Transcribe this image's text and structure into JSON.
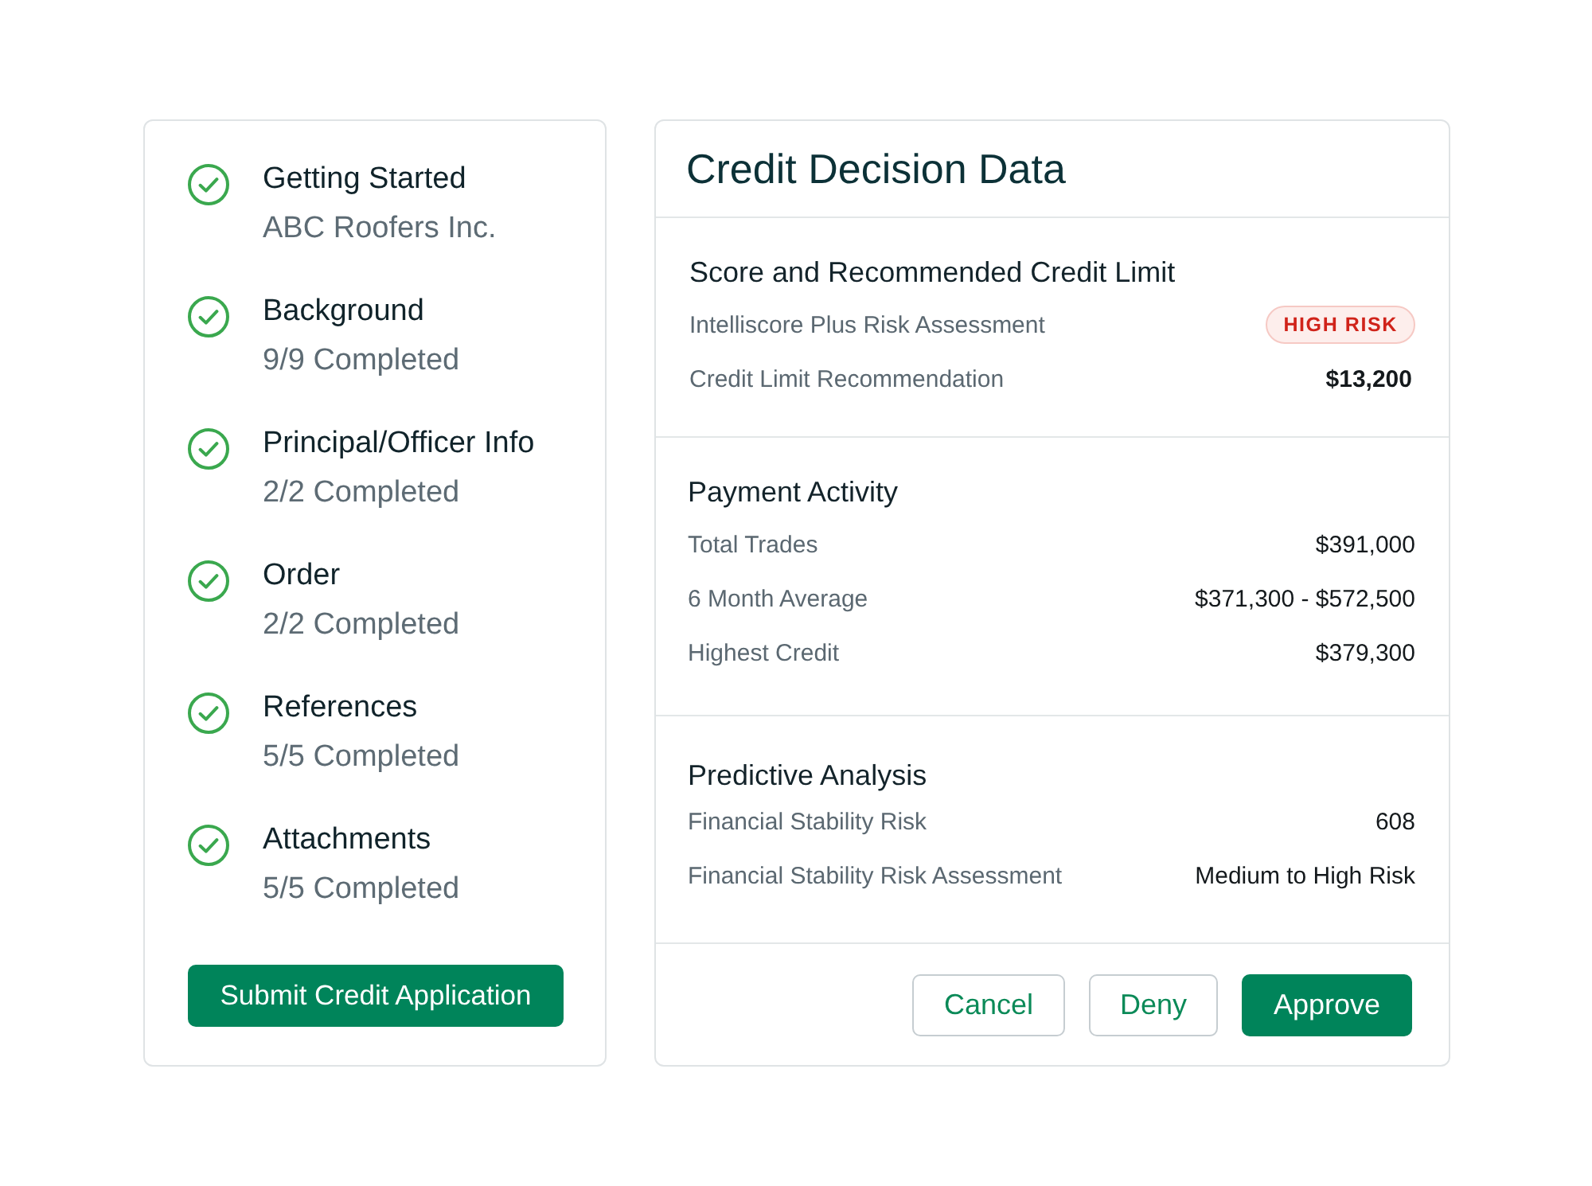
{
  "steps": [
    {
      "title": "Getting Started",
      "subtitle": "ABC Roofers Inc.",
      "completed": true
    },
    {
      "title": "Background",
      "subtitle": "9/9 Completed",
      "completed": true
    },
    {
      "title": "Principal/Officer Info",
      "subtitle": "2/2 Completed",
      "completed": true
    },
    {
      "title": "Order",
      "subtitle": "2/2 Completed",
      "completed": true
    },
    {
      "title": "References",
      "subtitle": "5/5 Completed",
      "completed": true
    },
    {
      "title": "Attachments",
      "subtitle": "5/5 Completed",
      "completed": true
    }
  ],
  "submit_button": "Submit Credit Application",
  "panel": {
    "title": "Credit Decision Data",
    "sections": [
      {
        "title": "Score and Recommended Credit Limit",
        "rows": [
          {
            "label": "Intelliscore Plus Risk Assessment",
            "value": "HIGH RISK",
            "kind": "badge"
          },
          {
            "label": "Credit Limit Recommendation",
            "value": "$13,200",
            "kind": "strong"
          }
        ]
      },
      {
        "title": "Payment Activity",
        "rows": [
          {
            "label": "Total Trades",
            "value": "$391,000",
            "kind": "plain"
          },
          {
            "label": "6 Month Average",
            "value": "$371,300 - $572,500",
            "kind": "plain"
          },
          {
            "label": "Highest Credit",
            "value": "$379,300",
            "kind": "plain"
          }
        ]
      },
      {
        "title": "Predictive Analysis",
        "rows": [
          {
            "label": "Financial Stability Risk",
            "value": "608",
            "kind": "plain"
          },
          {
            "label": "Financial Stability Risk Assessment",
            "value": "Medium to High Risk",
            "kind": "plain"
          }
        ]
      }
    ],
    "actions": [
      {
        "label": "Cancel",
        "kind": "secondary"
      },
      {
        "label": "Deny",
        "kind": "secondary"
      },
      {
        "label": "Approve",
        "kind": "primary"
      }
    ]
  }
}
